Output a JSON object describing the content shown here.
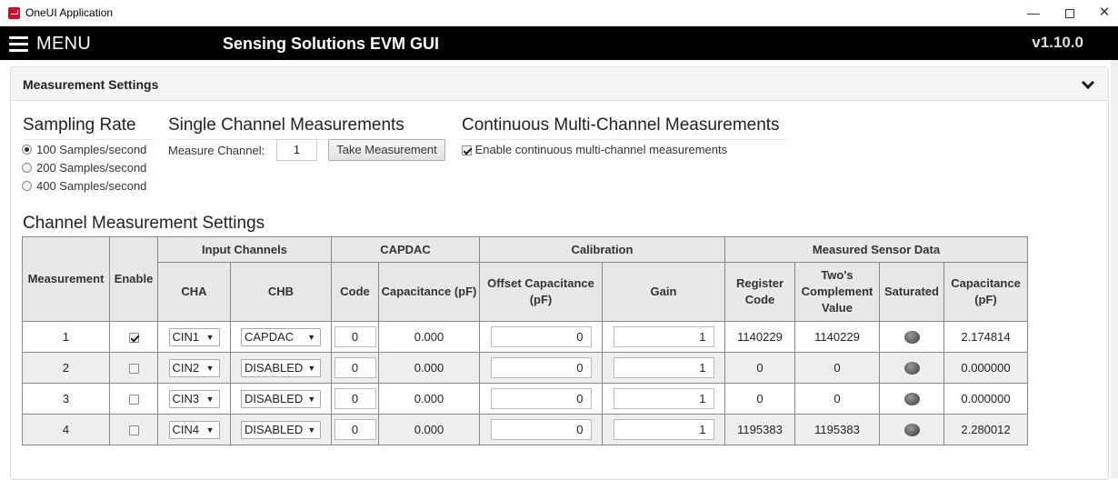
{
  "window": {
    "title": "OneUI Application"
  },
  "header": {
    "menu_label": "MENU",
    "app_title": "Sensing Solutions EVM GUI",
    "version": "v1.10.0"
  },
  "panel": {
    "title": "Measurement Settings"
  },
  "sampling_rate": {
    "title": "Sampling Rate",
    "options": [
      {
        "label": "100 Samples/second",
        "selected": true
      },
      {
        "label": "200 Samples/second",
        "selected": false
      },
      {
        "label": "400 Samples/second",
        "selected": false
      }
    ]
  },
  "single_channel": {
    "title": "Single Channel Measurements",
    "measure_channel_label": "Measure Channel:",
    "measure_channel_value": "1",
    "take_measurement_label": "Take Measurement"
  },
  "continuous": {
    "title": "Continuous Multi-Channel Measurements",
    "enable_label": "Enable continuous multi-channel measurements",
    "enabled": true
  },
  "channel_settings": {
    "title": "Channel Measurement Settings",
    "headers": {
      "measurement": "Measurement",
      "enable": "Enable",
      "input_channels": "Input Channels",
      "capdac": "CAPDAC",
      "calibration": "Calibration",
      "measured_sensor_data": "Measured Sensor Data",
      "cha": "CHA",
      "chb": "CHB",
      "code": "Code",
      "capacitance_pf": "Capacitance (pF)",
      "offset_capacitance": "Offset Capacitance (pF)",
      "gain": "Gain",
      "register_code": "Register Code",
      "twos_complement": "Two's Complement Value",
      "saturated": "Saturated",
      "capacitance_pf2": "Capacitance (pF)"
    },
    "rows": [
      {
        "measurement": "1",
        "enabled": true,
        "cha": "CIN1",
        "chb": "CAPDAC",
        "code": "0",
        "capdac_cap": "0.000",
        "offset": "0",
        "gain": "1",
        "register_code": "1140229",
        "twos_complement": "1140229",
        "capacitance": "2.174814"
      },
      {
        "measurement": "2",
        "enabled": false,
        "cha": "CIN2",
        "chb": "DISABLED",
        "code": "0",
        "capdac_cap": "0.000",
        "offset": "0",
        "gain": "1",
        "register_code": "0",
        "twos_complement": "0",
        "capacitance": "0.000000"
      },
      {
        "measurement": "3",
        "enabled": false,
        "cha": "CIN3",
        "chb": "DISABLED",
        "code": "0",
        "capdac_cap": "0.000",
        "offset": "0",
        "gain": "1",
        "register_code": "0",
        "twos_complement": "0",
        "capacitance": "0.000000"
      },
      {
        "measurement": "4",
        "enabled": false,
        "cha": "CIN4",
        "chb": "DISABLED",
        "code": "0",
        "capdac_cap": "0.000",
        "offset": "0",
        "gain": "1",
        "register_code": "1195383",
        "twos_complement": "1195383",
        "capacitance": "2.280012"
      }
    ]
  }
}
